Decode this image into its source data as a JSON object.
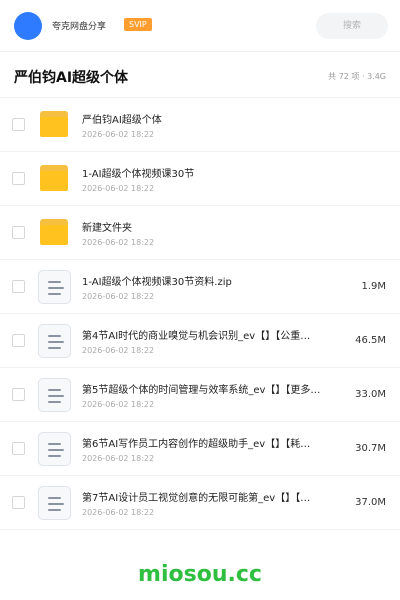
{
  "header": {
    "user_name": "夸克网盘分享",
    "badge": "SVIP",
    "search_placeholder": "搜索"
  },
  "folder": {
    "title": "严伯钧AI超级个体",
    "summary": "共 72 项 · 3.4G"
  },
  "items": [
    {
      "type": "folder",
      "name": "严伯钧AI超级个体",
      "date": "2026-06-02 18:22",
      "size": ""
    },
    {
      "type": "folder",
      "name": "1-AI超级个体视频课30节",
      "date": "2026-06-02 18:22",
      "size": ""
    },
    {
      "type": "folder",
      "name": "新建文件夹",
      "date": "2026-06-02 18:22",
      "size": ""
    },
    {
      "type": "file",
      "name": "1-AI超级个体视频课30节资料.zip",
      "date": "2026-06-02 18:22",
      "size": "1.9M"
    },
    {
      "type": "file",
      "name": "第4节AI时代的商业嗅觉与机会识别_ev【】【公重…",
      "date": "2026-06-02 18:22",
      "size": "46.5M"
    },
    {
      "type": "file",
      "name": "第5节超级个体的时间管理与效率系统_ev【】【更多…",
      "date": "2026-06-02 18:22",
      "size": "33.0M"
    },
    {
      "type": "file",
      "name": "第6节AI写作员工内容创作的超级助手_ev【】【耗…",
      "date": "2026-06-02 18:22",
      "size": "30.7M"
    },
    {
      "type": "file",
      "name": "第7节AI设计员工视觉创意的无限可能第_ev【】【…",
      "date": "2026-06-02 18:22",
      "size": "37.0M"
    }
  ],
  "watermark": "miosou.cc",
  "colors": {
    "accent": "#2f7bff",
    "badge": "#ff9d2e",
    "folder": "#ffc21f",
    "watermark": "#2fbf3f"
  }
}
